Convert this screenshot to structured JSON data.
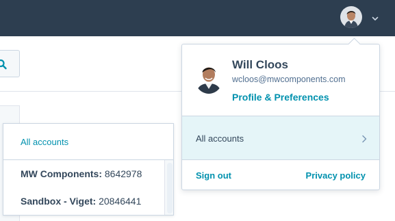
{
  "topbar": {
    "avatar_icon": "user-avatar-photo",
    "menu_chevron_icon": "chevron-down-icon",
    "background_color": "#2d3e50"
  },
  "background_page": {
    "search_icon": "search-icon"
  },
  "accounts_dropdown": {
    "all_accounts_label": "All accounts",
    "accounts": [
      {
        "name": "MW Components:",
        "id": "8642978"
      },
      {
        "name": "Sandbox - Viget:",
        "id": "20846441"
      }
    ]
  },
  "user_menu": {
    "name": "Will Cloos",
    "email": "wcloos@mwcomponents.com",
    "profile_link": "Profile & Preferences",
    "accounts_label": "All accounts",
    "sign_out": "Sign out",
    "privacy_policy": "Privacy policy"
  },
  "colors": {
    "link": "#0091ae",
    "text": "#33475b",
    "highlight": "#e5f5f8"
  }
}
